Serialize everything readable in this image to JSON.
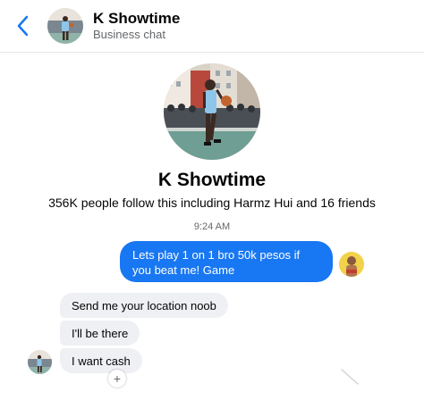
{
  "header": {
    "back_icon": "chevron-left-icon",
    "name": "K Showtime",
    "subtitle": "Business chat"
  },
  "profile": {
    "name": "K Showtime",
    "followers_text": "356K people follow this including Harmz Hui and 16 friends"
  },
  "conversation": {
    "timestamp": "9:24 AM",
    "messages": [
      {
        "from": "me",
        "text": "Lets play 1 on 1 bro 50k pesos if you beat me! Game"
      },
      {
        "from": "them",
        "text": "Send me your location noob"
      },
      {
        "from": "them",
        "text": "I'll be there"
      },
      {
        "from": "them",
        "text": "I want cash"
      }
    ],
    "react_symbol": "+"
  },
  "colors": {
    "accent": "#1877f2",
    "incoming_bubble": "#eef0f3",
    "secondary_text": "#65676b"
  }
}
